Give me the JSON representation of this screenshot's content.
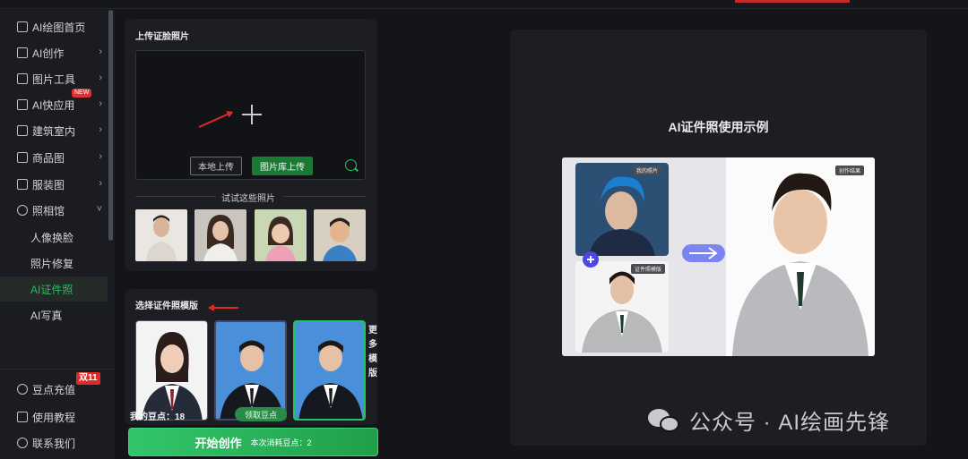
{
  "sidebar": {
    "items": [
      {
        "label": "AI绘图首页",
        "icon": "home-icon",
        "chevron": false
      },
      {
        "label": "AI创作",
        "icon": "brush-icon",
        "chevron": true
      },
      {
        "label": "图片工具",
        "icon": "toolbox-icon",
        "chevron": true
      },
      {
        "label": "AI快应用",
        "icon": "cube-icon",
        "chevron": true,
        "badge": "NEW"
      },
      {
        "label": "建筑室内",
        "icon": "building-icon",
        "chevron": true
      },
      {
        "label": "商品图",
        "icon": "bag-icon",
        "chevron": true
      },
      {
        "label": "服装图",
        "icon": "shirt-icon",
        "chevron": true
      },
      {
        "label": "照相馆",
        "icon": "camera-icon",
        "chevron": true,
        "expanded": true
      }
    ],
    "subitems": [
      "人像换脸",
      "照片修复",
      "AI证件照",
      "AI写真"
    ],
    "active_sub": "AI证件照",
    "bottom": [
      {
        "label": "豆点充值",
        "icon": "diamond-icon",
        "promo": "双11"
      },
      {
        "label": "使用教程",
        "icon": "book-icon"
      },
      {
        "label": "联系我们",
        "icon": "headset-icon"
      }
    ]
  },
  "upload": {
    "title": "上传证脸照片",
    "local_button": "本地上传",
    "gallery_button": "图片库上传",
    "try_label": "试试这些照片"
  },
  "template": {
    "title": "选择证件照模版",
    "more": [
      "更",
      "多",
      "模",
      "版"
    ],
    "points_label": "我的豆点：18",
    "get_points_button": "领取豆点",
    "start_button": "开始创作",
    "cost_label": "本次消耗豆点：2"
  },
  "preview": {
    "title": "AI证件照使用示例",
    "tag_my_photo": "我的照片",
    "tag_template": "证件照模版",
    "tag_result": "创作结果"
  },
  "watermark": {
    "text": "公众号 · AI绘画先锋"
  },
  "colors": {
    "accent": "#22c55e",
    "badge_red": "#e02929",
    "background": "#141519"
  }
}
